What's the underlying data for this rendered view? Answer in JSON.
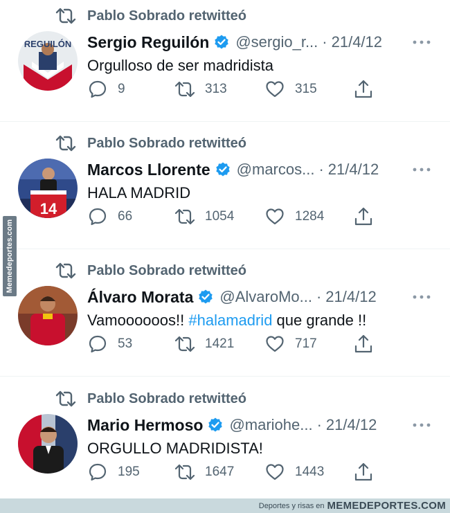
{
  "retweet_label": "Pablo Sobrado retwitteó",
  "tweets": [
    {
      "name": "Sergio Reguilón",
      "handle": "@sergio_r...",
      "date": "21/4/12",
      "text": "Orgulloso de ser madridista",
      "replies": "9",
      "retweets": "313",
      "likes": "315",
      "avatar_text": "REGUILÓN"
    },
    {
      "name": "Marcos Llorente",
      "handle": "@marcos...",
      "date": "21/4/12",
      "text": "HALA MADRID",
      "replies": "66",
      "retweets": "1054",
      "likes": "1284",
      "avatar_text": "14"
    },
    {
      "name": "Álvaro Morata",
      "handle": "@AlvaroMo...",
      "date": "21/4/12",
      "text_before": "Vamoooooos!! ",
      "hashtag": "#halamadrid",
      "text_after": " que grande !!",
      "replies": "53",
      "retweets": "1421",
      "likes": "717"
    },
    {
      "name": "Mario Hermoso",
      "handle": "@mariohe...",
      "date": "21/4/12",
      "text": "ORGULLO MADRIDISTA!",
      "replies": "195",
      "retweets": "1647",
      "likes": "1443"
    }
  ],
  "watermark_side": "Memedeportes.com",
  "footer": {
    "small": "Deportes y risas en",
    "brand": "MEMEDEPORTES.COM"
  },
  "colors": {
    "text_primary": "#0f1419",
    "text_secondary": "#536471",
    "verified_blue": "#1d9bf0",
    "hashtag_blue": "#1d9bf0"
  },
  "icons": [
    "retweet-icon",
    "verified-badge-icon",
    "more-icon",
    "reply-icon",
    "like-icon",
    "share-icon"
  ]
}
